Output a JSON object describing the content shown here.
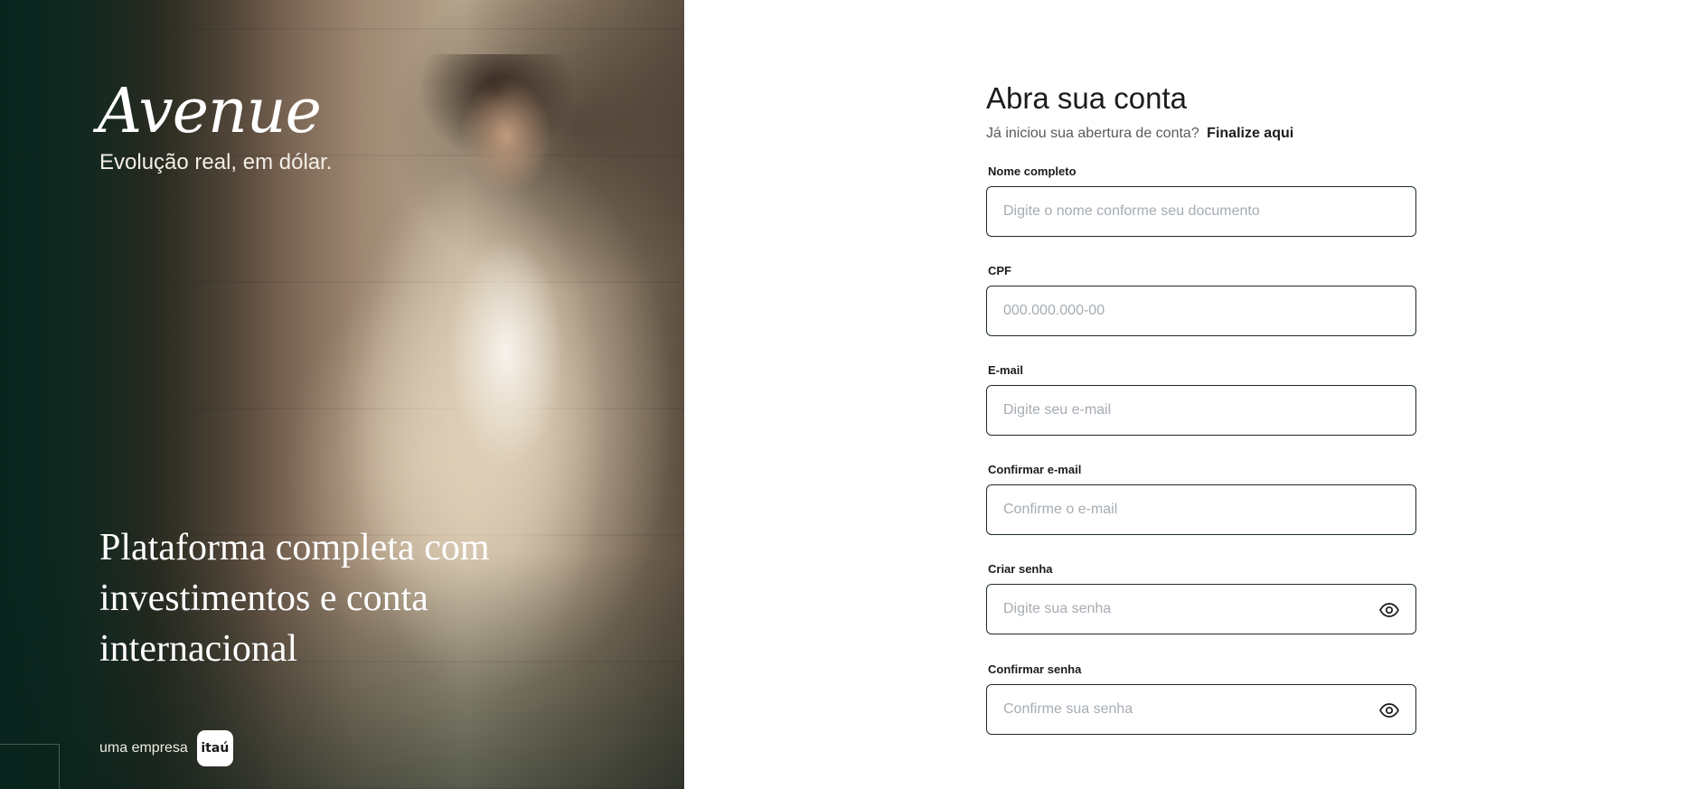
{
  "hero": {
    "logo_text": "Avenue",
    "tagline": "Evolução real, em dólar.",
    "headline": "Plataforma completa com investimentos e conta internacional",
    "footer_prefix": "uma empresa",
    "partner_logo_text": "itaú"
  },
  "form": {
    "title": "Abra sua conta",
    "subtitle": "Já iniciou sua abertura de conta?",
    "subtitle_link": "Finalize aqui",
    "fields": [
      {
        "label": "Nome completo",
        "placeholder": "Digite o nome conforme seu documento",
        "value": ""
      },
      {
        "label": "CPF",
        "placeholder": "000.000.000-00",
        "value": ""
      },
      {
        "label": "E-mail",
        "placeholder": "Digite seu e-mail",
        "value": ""
      },
      {
        "label": "Confirmar e-mail",
        "placeholder": "Confirme o e-mail",
        "value": ""
      },
      {
        "label": "Criar senha",
        "placeholder": "Digite sua senha",
        "value": ""
      },
      {
        "label": "Confirmar senha",
        "placeholder": "Confirme sua senha",
        "value": ""
      }
    ]
  },
  "icons": {
    "password_toggle": "eye-icon",
    "partner_logo": "itau-logo"
  },
  "colors": {
    "hero_green": "#0d2a23",
    "input_border": "#1f2c28",
    "text_primary": "#1c1c1c",
    "placeholder": "#a6acb2"
  }
}
